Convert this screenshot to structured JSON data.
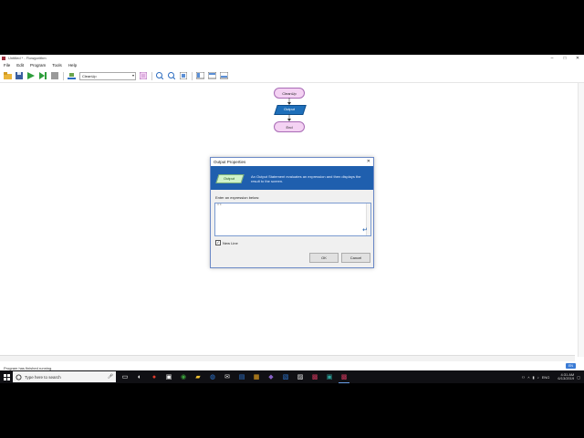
{
  "window": {
    "title": "Untitled * - Flowgorithm",
    "controls": {
      "minimize": "–",
      "maximize": "□",
      "close": "✕"
    }
  },
  "menu": [
    "File",
    "Edit",
    "Program",
    "Tools",
    "Help"
  ],
  "toolbar": {
    "icons": [
      "open-icon",
      "save-icon",
      "run-icon",
      "step-icon",
      "stop-icon",
      "layout-icon",
      "zoom-in-icon",
      "zoom-out-icon",
      "fit-icon",
      "screen-icon",
      "compact-icon",
      "wide-icon"
    ],
    "function_select": "CleanUp"
  },
  "flowchart": {
    "start_label": "CleanUp",
    "output_label": "Output",
    "end_label": "End"
  },
  "dialog": {
    "title": "Output Properties",
    "close": "✕",
    "banner_shape_label": "Output",
    "banner_text": "An Output Statement evaluates an expression and then displays the result to the screen.",
    "prompt": "Enter an expression below:",
    "expression_value": "\"\"",
    "enter_glyph": "↵",
    "newline_label": "New Line",
    "newline_checked": true,
    "ok_label": "OK",
    "cancel_label": "Cancel"
  },
  "status": {
    "message": "Program has finished running.",
    "zoom_badge": "EN"
  },
  "taskbar": {
    "search_placeholder": "Type here to search",
    "time": "4:31 AM",
    "date": "6/13/2019"
  },
  "colors": {
    "start_end_fill": "#f4d2f3",
    "output_fill": "#1e6fba",
    "banner_blue": "#1f5fae"
  }
}
